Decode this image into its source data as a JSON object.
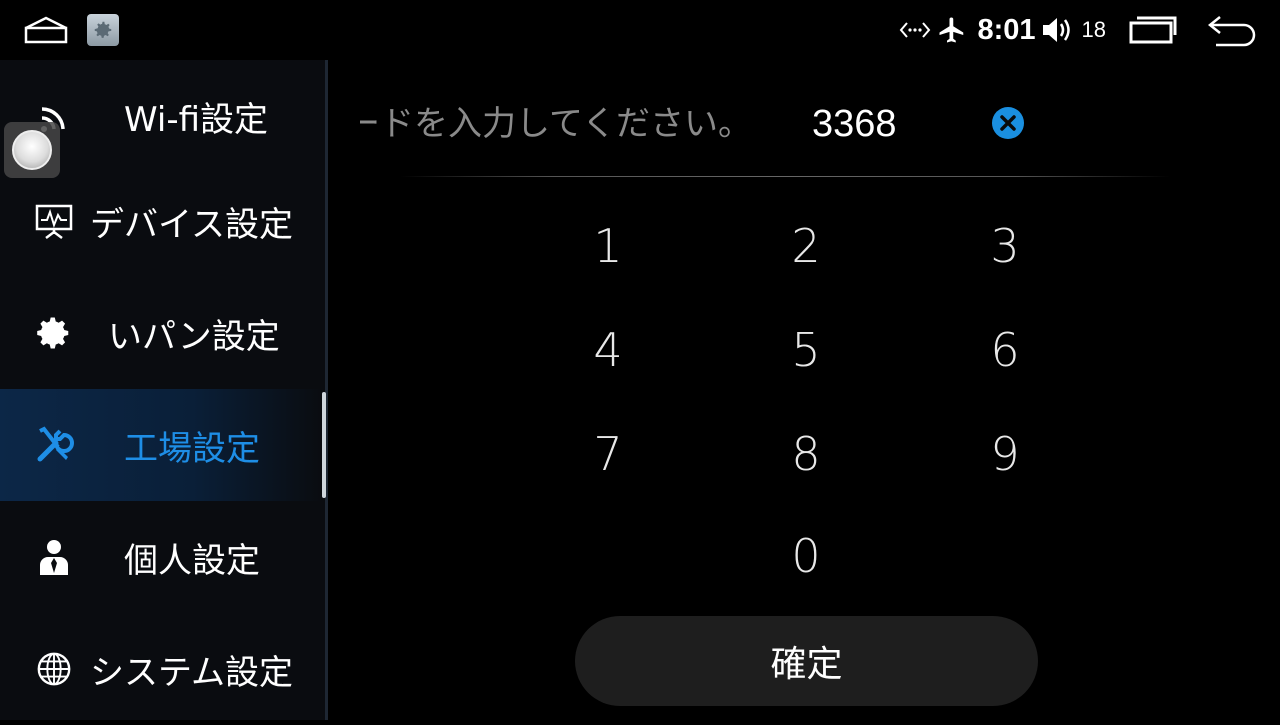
{
  "status_bar": {
    "time": "8:01",
    "volume_level": "18"
  },
  "sidebar": {
    "items": [
      {
        "label": "Wi-fi設定",
        "icon": "wifi-icon",
        "active": false
      },
      {
        "label": "デバイス設定",
        "icon": "monitor-pulse-icon",
        "active": false
      },
      {
        "label": "いパン設定",
        "icon": "gear-icon",
        "active": false
      },
      {
        "label": "工場設定",
        "icon": "wrench-screwdriver-icon",
        "active": true
      },
      {
        "label": "個人設定",
        "icon": "person-icon",
        "active": false
      },
      {
        "label": "システム設定",
        "icon": "globe-icon",
        "active": false
      }
    ],
    "accent_color": "#1e8ee6"
  },
  "password": {
    "prompt": "パスワードを入力してください。",
    "value": "3368",
    "clear_icon": "clear-circle-icon",
    "clear_color": "#1a8fe0"
  },
  "keypad": {
    "keys": [
      "1",
      "2",
      "3",
      "4",
      "5",
      "6",
      "7",
      "8",
      "9",
      "0"
    ]
  },
  "confirm": {
    "label": "確定"
  }
}
